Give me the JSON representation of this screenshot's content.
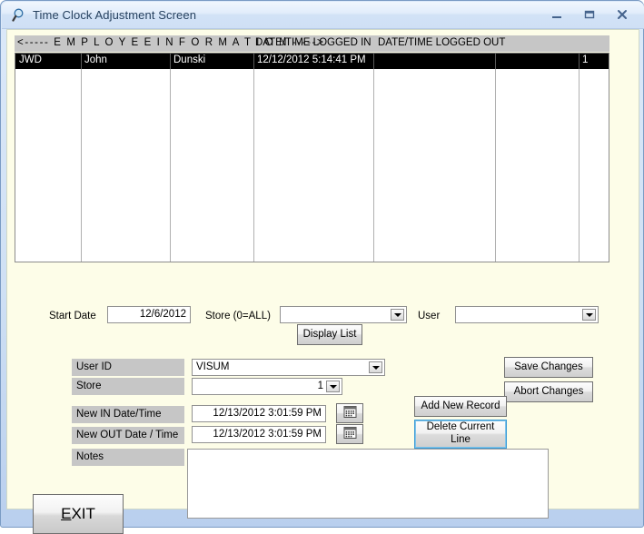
{
  "window": {
    "title": "Time Clock Adjustment Screen",
    "icon": "magnifier-icon",
    "minimize_label": "–",
    "maximize_label": "☐",
    "close_label": "X",
    "frame_color": "#b9cfee",
    "client_bg": "#fdfde8"
  },
  "grid": {
    "header": {
      "employee_info": "<----- E M P L O Y E E   I N F O R M A T I O N ----->",
      "logged_in": "DATE/TIME LOGGED IN",
      "logged_out": "DATE/TIME LOGGED OUT"
    },
    "selected_row_bg": "#000000",
    "rows": [
      {
        "user_id": "JWD",
        "first_name": "John",
        "last_name": "Dunski",
        "datetime_in": "12/12/2012 5:14:41 PM",
        "datetime_out": "",
        "extra": "",
        "store": "1",
        "selected": true
      }
    ]
  },
  "filters": {
    "start_date_label": "Start Date",
    "start_date_value": "12/6/2012",
    "store_label": "Store (0=ALL)",
    "store_value": "",
    "user_label": "User",
    "user_value": "",
    "display_list_label": "Display List"
  },
  "form": {
    "user_id_label": "User ID",
    "user_id_value": "VISUM",
    "store_label": "Store",
    "store_value": "1",
    "new_in_label": "New IN Date/Time",
    "new_in_value": "12/13/2012 3:01:59 PM",
    "new_out_label": "New OUT Date / Time",
    "new_out_value": "12/13/2012 3:01:59 PM",
    "notes_label": "Notes",
    "notes_value": "",
    "calendar_icon_in": "calendar-icon",
    "calendar_icon_out": "calendar-icon"
  },
  "actions": {
    "save_changes": "Save Changes",
    "abort_changes": "Abort Changes",
    "add_new_record": "Add New Record",
    "delete_current_line": "Delete Current\nLine",
    "delete_line_1": "Delete Current",
    "delete_line_2": "Line",
    "exit_accel": "E",
    "exit_rest": "XIT",
    "focus_color": "#3c9bd6"
  }
}
